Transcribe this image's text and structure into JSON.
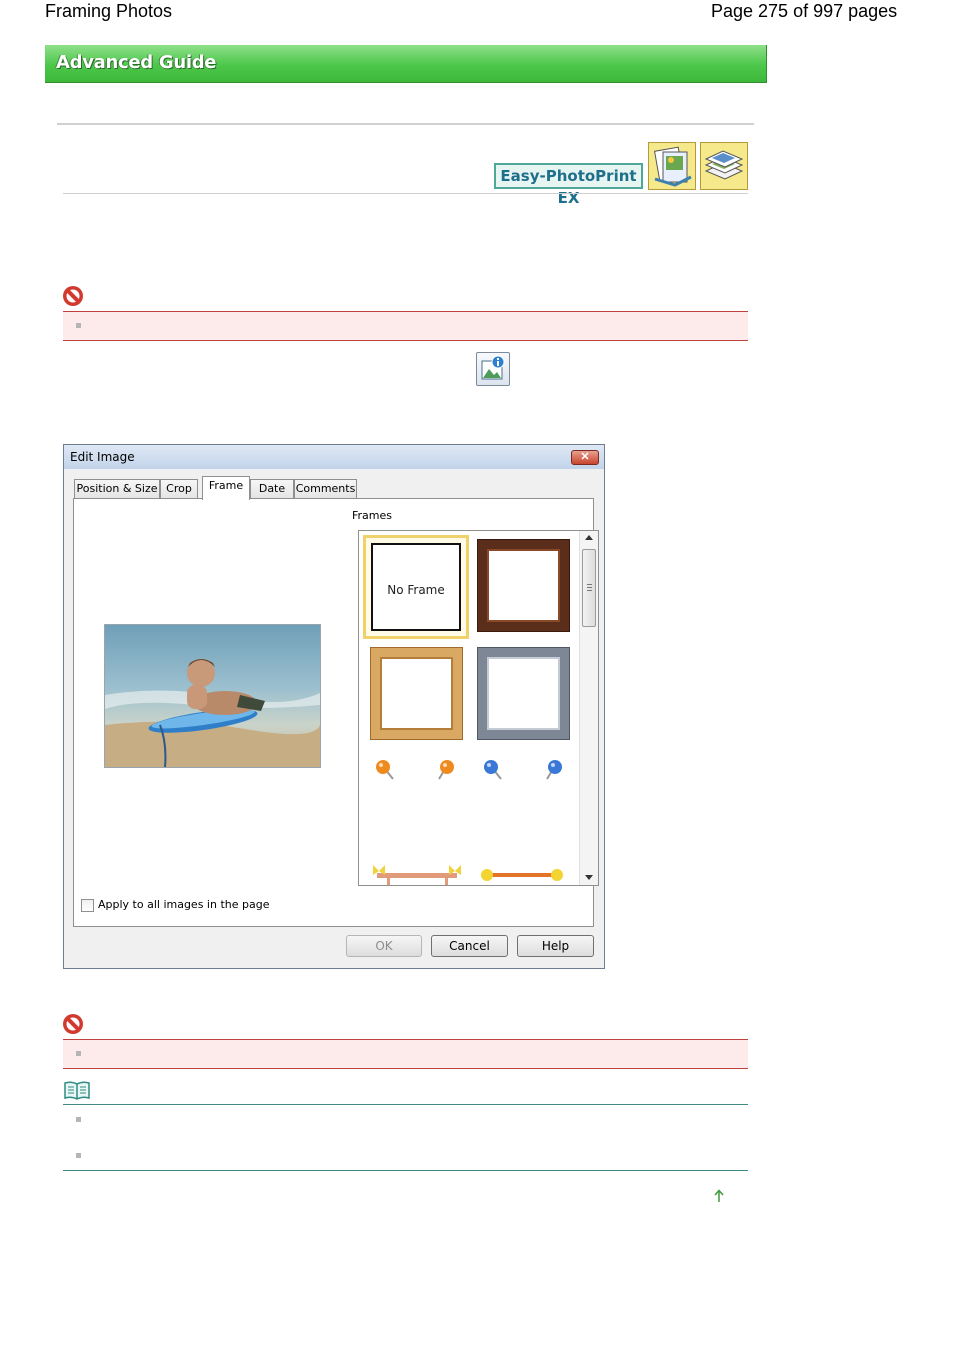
{
  "header": {
    "doc_title": "Framing Photos",
    "page_info": "Page 275 of 997 pages"
  },
  "banner": {
    "label": "Advanced Guide"
  },
  "product": {
    "label": "Easy-PhotoPrint EX",
    "icon1": "album-icon",
    "icon2": "photo-print-icon"
  },
  "colors": {
    "banner_green": "#4cc74a",
    "warning_red": "#c0403b",
    "warning_bg": "#fcebea",
    "note_teal": "#3f8a85"
  },
  "dialog": {
    "title": "Edit Image",
    "tabs": [
      {
        "label": "Position & Size"
      },
      {
        "label": "Crop"
      },
      {
        "label": "Frame"
      },
      {
        "label": "Date"
      },
      {
        "label": "Comments"
      }
    ],
    "active_tab": "Frame",
    "frames_label": "Frames",
    "no_frame_label": "No Frame",
    "apply_all_label": "Apply to all images in the page",
    "apply_all_checked": false,
    "ok_label": "OK",
    "cancel_label": "Cancel",
    "help_label": "Help"
  }
}
